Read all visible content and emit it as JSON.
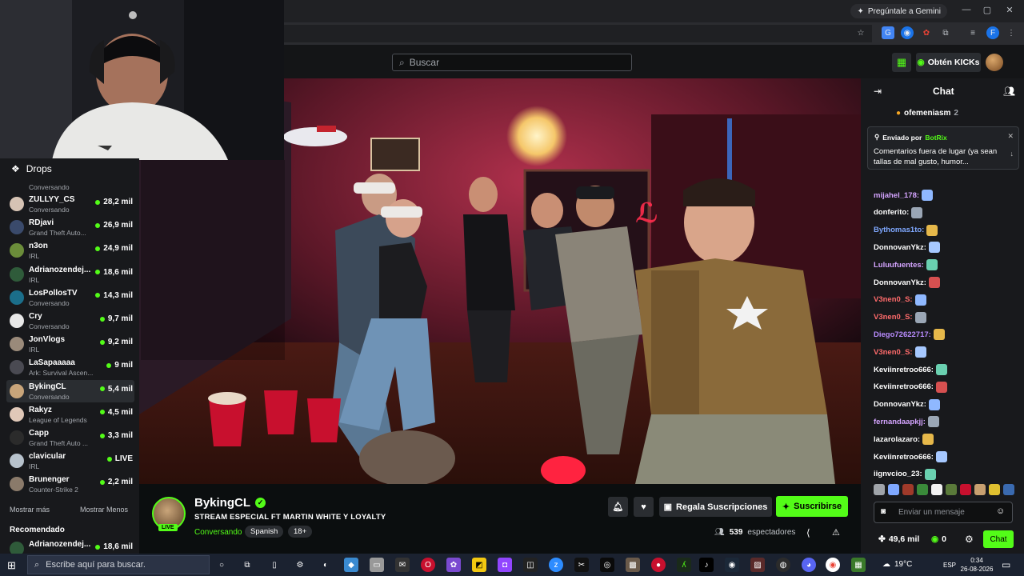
{
  "browser": {
    "gemini_label": "Pregúntale a Gemini",
    "window_controls": [
      "—",
      "▢",
      "✕"
    ],
    "profile_initial": "F"
  },
  "header": {
    "search_placeholder": "Buscar",
    "kicks_label": "Obtén KICKs"
  },
  "sidebar": {
    "drops_label": "Drops",
    "first_cat": "Conversando",
    "channels": [
      {
        "name": "ZULLYY_CS",
        "category": "Conversando",
        "viewers": "28,2 mil",
        "color": "#d6c3b4"
      },
      {
        "name": "RDjavi",
        "category": "Grand Theft Auto...",
        "viewers": "26,9 mil",
        "color": "#3a4a6b"
      },
      {
        "name": "n3on",
        "category": "IRL",
        "viewers": "24,9 mil",
        "color": "#6b8d3a"
      },
      {
        "name": "Adrianozendej...",
        "category": "IRL",
        "viewers": "18,6 mil",
        "color": "#2f5b3a"
      },
      {
        "name": "LosPollosTV",
        "category": "Conversando",
        "viewers": "14,3 mil",
        "color": "#1b6e8a"
      },
      {
        "name": "Cry",
        "category": "Conversando",
        "viewers": "9,7 mil",
        "color": "#e8e8e8"
      },
      {
        "name": "JonVlogs",
        "category": "IRL",
        "viewers": "9,2 mil",
        "color": "#9a8a7a"
      },
      {
        "name": "LaSapaaaaa",
        "category": "Ark: Survival Ascen...",
        "viewers": "9 mil",
        "color": "#4a4a52"
      },
      {
        "name": "BykingCL",
        "category": "Conversando",
        "viewers": "5,4 mil",
        "color": "#c9a57a"
      },
      {
        "name": "Rakyz",
        "category": "League of Legends",
        "viewers": "4,5 mil",
        "color": "#e0c8b8"
      },
      {
        "name": "Capp",
        "category": "Grand Theft Auto ...",
        "viewers": "3,3 mil",
        "color": "#2b2b2b"
      },
      {
        "name": "clavicular",
        "category": "IRL",
        "viewers": "LIVE",
        "color": "#b7c2cc"
      },
      {
        "name": "Brunenger",
        "category": "Counter-Strike 2",
        "viewers": "2,2 mil",
        "color": "#8a7a6a"
      }
    ],
    "show_more": "Mostrar más",
    "show_less": "Mostrar Menos",
    "recommended_label": "Recomendado",
    "recommended": [
      {
        "name": "Adrianozendej...",
        "viewers": "18,6 mil",
        "color": "#2f5b3a"
      }
    ]
  },
  "stream": {
    "streamer": "BykingCL",
    "live_badge": "LIVE",
    "title": "STREAM ESPECIAL FT MARTIN WHITE Y LOYALTY",
    "category": "Conversando",
    "tags": [
      "Spanish",
      "18+"
    ],
    "gift_subs_label": "Regala Suscripciones",
    "subscribe_label": "Suscribirse",
    "viewer_count": "539",
    "viewer_label": "espectadores"
  },
  "chat": {
    "title": "Chat",
    "top_user": "ofemeniasm",
    "top_count": "2",
    "pinned_by_label": "Enviado por",
    "pinned_by_user": "BotRix",
    "pinned_text": "Comentarios fuera de lugar (ya sean tallas de mal gusto, humor...",
    "messages": [
      {
        "user": "mijahel_178:",
        "color": "#d4a4ff"
      },
      {
        "user": "donferito:",
        "color": "#ffffff"
      },
      {
        "user": "Bythomas1to:",
        "color": "#7fa8ff"
      },
      {
        "user": "DonnovanYkz:",
        "color": "#ffffff"
      },
      {
        "user": "Luluufuentes:",
        "color": "#d4a4ff"
      },
      {
        "user": "DonnovanYkz:",
        "color": "#ffffff"
      },
      {
        "user": "V3nen0_S:",
        "color": "#ff6b6b"
      },
      {
        "user": "V3nen0_S:",
        "color": "#ff6b6b"
      },
      {
        "user": "Diego72622717:",
        "color": "#b98cff"
      },
      {
        "user": "V3nen0_S:",
        "color": "#ff6b6b"
      },
      {
        "user": "Keviinretroo666:",
        "color": "#ffffff"
      },
      {
        "user": "Keviinretroo666:",
        "color": "#ffffff"
      },
      {
        "user": "DonnovanYkz:",
        "color": "#ffffff"
      },
      {
        "user": "fernandaapkjj:",
        "color": "#d4a4ff"
      },
      {
        "user": "lazarolazaro:",
        "color": "#ffffff"
      },
      {
        "user": "Keviinretroo666:",
        "color": "#ffffff"
      },
      {
        "user": "iignvcioo_23:",
        "color": "#ffffff"
      }
    ],
    "input_placeholder": "Enviar un mensaje",
    "points": "49,6 mil",
    "kicks": "0",
    "send_label": "Chat"
  },
  "taskbar": {
    "search_placeholder": "Escribe aquí para buscar.",
    "weather": "19°C",
    "language": "ESP",
    "time": "0:34",
    "date": "26-08-2026"
  },
  "colors": {
    "kick_green": "#53fc18",
    "panel_bg": "#18191c",
    "page_bg": "#0b0e0f"
  }
}
